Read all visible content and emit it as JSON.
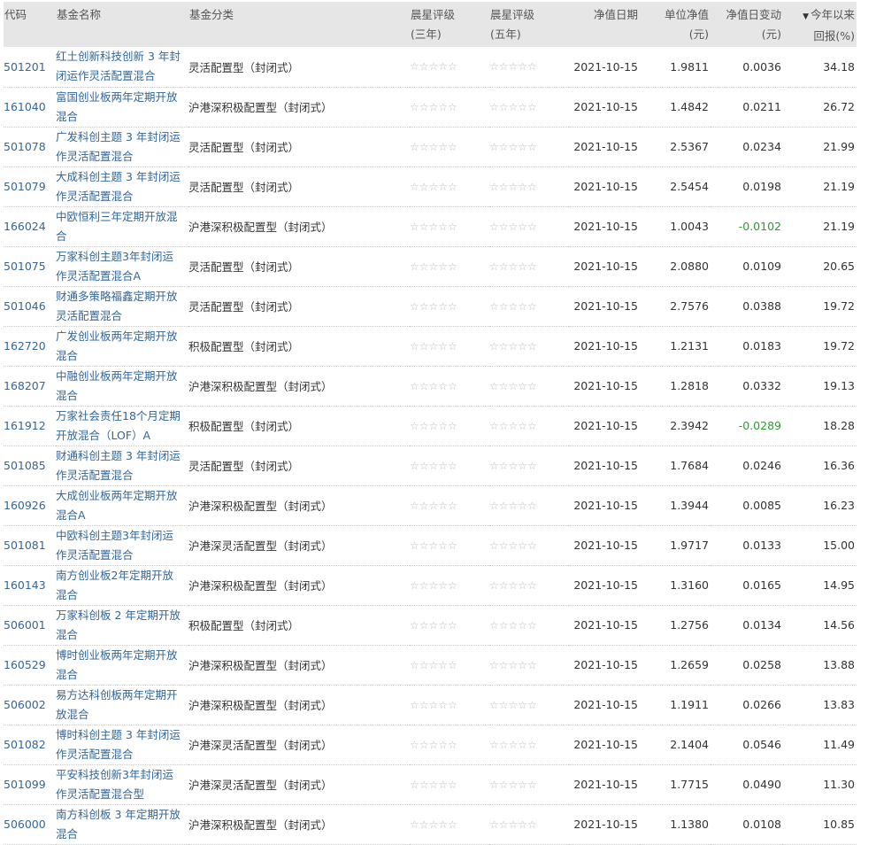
{
  "header": {
    "code": "代码",
    "name": "基金名称",
    "category": "基金分类",
    "rating3_line1": "晨星评级",
    "rating3_line2": "(三年)",
    "rating5_line1": "晨星评级",
    "rating5_line2": "(五年)",
    "nav_date": "净值日期",
    "unit_nav_line1": "单位净值",
    "unit_nav_line2": "(元)",
    "nav_change_line1": "净值日变动",
    "nav_change_line2": "(元)",
    "ytd_line1": "今年以来",
    "ytd_line2": "回报(%)",
    "sort_icon": "▼"
  },
  "colors": {
    "link": "#336699",
    "negative": "#2e9a2e",
    "header_bg": "#e6e6e6"
  },
  "rows": [
    {
      "code": "501201",
      "name1": "红土创新科技创新 3 年封",
      "name2": "闭运作灵活配置混合",
      "category": "灵活配置型（封闭式）",
      "r3": "☆☆☆☆☆",
      "r5": "☆☆☆☆☆",
      "date": "2021-10-15",
      "nav": "1.9811",
      "chg": "0.0036",
      "ytd": "34.18"
    },
    {
      "code": "161040",
      "name1": "富国创业板两年定期开放",
      "name2": "混合",
      "category": "沪港深积极配置型（封闭式）",
      "r3": "☆☆☆☆☆",
      "r5": "☆☆☆☆☆",
      "date": "2021-10-15",
      "nav": "1.4842",
      "chg": "0.0211",
      "ytd": "26.72"
    },
    {
      "code": "501078",
      "name1": "广发科创主题 3 年封闭运",
      "name2": "作灵活配置混合",
      "category": "灵活配置型（封闭式）",
      "r3": "☆☆☆☆☆",
      "r5": "☆☆☆☆☆",
      "date": "2021-10-15",
      "nav": "2.5367",
      "chg": "0.0234",
      "ytd": "21.99"
    },
    {
      "code": "501079",
      "name1": "大成科创主题 3 年封闭运",
      "name2": "作灵活配置混合",
      "category": "灵活配置型（封闭式）",
      "r3": "☆☆☆☆☆",
      "r5": "☆☆☆☆☆",
      "date": "2021-10-15",
      "nav": "2.5454",
      "chg": "0.0198",
      "ytd": "21.19"
    },
    {
      "code": "166024",
      "name1": "中欧恒利三年定期开放混",
      "name2": "合",
      "category": "沪港深积极配置型（封闭式）",
      "r3": "☆☆☆☆☆",
      "r5": "☆☆☆☆☆",
      "date": "2021-10-15",
      "nav": "1.0043",
      "chg": "-0.0102",
      "ytd": "21.19",
      "neg": true
    },
    {
      "code": "501075",
      "name1": "万家科创主题3年封闭运",
      "name2": "作灵活配置混合A",
      "category": "灵活配置型（封闭式）",
      "r3": "☆☆☆☆☆",
      "r5": "☆☆☆☆☆",
      "date": "2021-10-15",
      "nav": "2.0880",
      "chg": "0.0109",
      "ytd": "20.65"
    },
    {
      "code": "501046",
      "name1": "财通多策略福鑫定期开放",
      "name2": "灵活配置混合",
      "category": "灵活配置型（封闭式）",
      "r3": "☆☆☆☆☆",
      "r5": "☆☆☆☆☆",
      "date": "2021-10-15",
      "nav": "2.7576",
      "chg": "0.0388",
      "ytd": "19.72"
    },
    {
      "code": "162720",
      "name1": "广发创业板两年定期开放",
      "name2": "混合",
      "category": "积极配置型（封闭式）",
      "r3": "☆☆☆☆☆",
      "r5": "☆☆☆☆☆",
      "date": "2021-10-15",
      "nav": "1.2131",
      "chg": "0.0183",
      "ytd": "19.72"
    },
    {
      "code": "168207",
      "name1": "中融创业板两年定期开放",
      "name2": "混合",
      "category": "沪港深积极配置型（封闭式）",
      "r3": "☆☆☆☆☆",
      "r5": "☆☆☆☆☆",
      "date": "2021-10-15",
      "nav": "1.2818",
      "chg": "0.0332",
      "ytd": "19.13"
    },
    {
      "code": "161912",
      "name1": "万家社会责任18个月定期",
      "name2": "开放混合（LOF）A",
      "category": "积极配置型（封闭式）",
      "r3": "☆☆☆☆☆",
      "r5": "☆☆☆☆☆",
      "date": "2021-10-15",
      "nav": "2.3942",
      "chg": "-0.0289",
      "ytd": "18.28",
      "neg": true
    },
    {
      "code": "501085",
      "name1": "财通科创主题 3 年封闭运",
      "name2": "作灵活配置混合",
      "category": "灵活配置型（封闭式）",
      "r3": "☆☆☆☆☆",
      "r5": "☆☆☆☆☆",
      "date": "2021-10-15",
      "nav": "1.7684",
      "chg": "0.0246",
      "ytd": "16.36"
    },
    {
      "code": "160926",
      "name1": "大成创业板两年定期开放",
      "name2": "混合A",
      "category": "沪港深积极配置型（封闭式）",
      "r3": "☆☆☆☆☆",
      "r5": "☆☆☆☆☆",
      "date": "2021-10-15",
      "nav": "1.3944",
      "chg": "0.0085",
      "ytd": "16.23"
    },
    {
      "code": "501081",
      "name1": "中欧科创主题3年封闭运",
      "name2": "作灵活配置混合",
      "category": "沪港深灵活配置型（封闭式）",
      "r3": "☆☆☆☆☆",
      "r5": "☆☆☆☆☆",
      "date": "2021-10-15",
      "nav": "1.9717",
      "chg": "0.0133",
      "ytd": "15.00"
    },
    {
      "code": "160143",
      "name1": "南方创业板2年定期开放",
      "name2": "混合",
      "category": "沪港深积极配置型（封闭式）",
      "r3": "☆☆☆☆☆",
      "r5": "☆☆☆☆☆",
      "date": "2021-10-15",
      "nav": "1.3160",
      "chg": "0.0165",
      "ytd": "14.95"
    },
    {
      "code": "506001",
      "name1": "万家科创板 2 年定期开放",
      "name2": "混合",
      "category": "积极配置型（封闭式）",
      "r3": "☆☆☆☆☆",
      "r5": "☆☆☆☆☆",
      "date": "2021-10-15",
      "nav": "1.2756",
      "chg": "0.0134",
      "ytd": "14.56"
    },
    {
      "code": "160529",
      "name1": "博时创业板两年定期开放",
      "name2": "混合",
      "category": "沪港深积极配置型（封闭式）",
      "r3": "☆☆☆☆☆",
      "r5": "☆☆☆☆☆",
      "date": "2021-10-15",
      "nav": "1.2659",
      "chg": "0.0258",
      "ytd": "13.88"
    },
    {
      "code": "506002",
      "name1": "易方达科创板两年定期开",
      "name2": "放混合",
      "category": "沪港深积极配置型（封闭式）",
      "r3": "☆☆☆☆☆",
      "r5": "☆☆☆☆☆",
      "date": "2021-10-15",
      "nav": "1.1911",
      "chg": "0.0266",
      "ytd": "13.83"
    },
    {
      "code": "501082",
      "name1": "博时科创主题 3 年封闭运",
      "name2": "作灵活配置混合",
      "category": "沪港深灵活配置型（封闭式）",
      "r3": "☆☆☆☆☆",
      "r5": "☆☆☆☆☆",
      "date": "2021-10-15",
      "nav": "2.1404",
      "chg": "0.0546",
      "ytd": "11.49"
    },
    {
      "code": "501099",
      "name1": "平安科技创新3年封闭运",
      "name2": "作灵活配置混合型",
      "category": "沪港深灵活配置型（封闭式）",
      "r3": "☆☆☆☆☆",
      "r5": "☆☆☆☆☆",
      "date": "2021-10-15",
      "nav": "1.7715",
      "chg": "0.0490",
      "ytd": "11.30"
    },
    {
      "code": "506000",
      "name1": "南方科创板 3 年定期开放",
      "name2": "混合",
      "category": "沪港深积极配置型（封闭式）",
      "r3": "☆☆☆☆☆",
      "r5": "☆☆☆☆☆",
      "date": "2021-10-15",
      "nav": "1.1380",
      "chg": "0.0108",
      "ytd": "10.85"
    }
  ]
}
